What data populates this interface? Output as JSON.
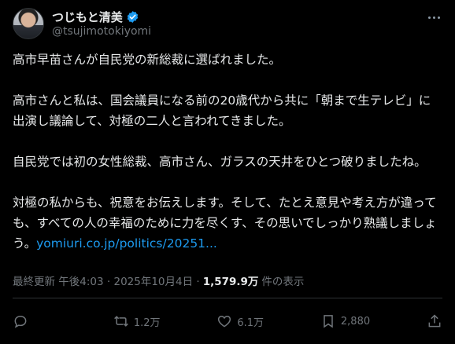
{
  "author": {
    "display_name": "つじもと清美",
    "handle": "@tsujimotokiyomi"
  },
  "post": {
    "paragraphs": [
      "高市早苗さんが自民党の新総裁に選ばれました。",
      "高市さんと私は、国会議員になる前の20歳代から共に「朝まで生テレビ」に出演し議論して、対極の二人と言われてきました。",
      "自民党では初の女性総裁、高市さん、ガラスの天井をひとつ破りましたね。"
    ],
    "last_paragraph_text": "対極の私からも、祝意をお伝えします。そして、たとえ意見や考え方が違っても、すべての人の幸福のために力を尽くす、その思いでしっかり熟議しましょう。",
    "link_text": "yomiuri.co.jp/politics/20251..."
  },
  "meta": {
    "prefix": "最終更新 午後4:03 · 2025年10月4日 ·",
    "views": "1,579.9万",
    "views_label": "件の表示"
  },
  "actions": {
    "reply": "",
    "repost": "1.2万",
    "like": "6.1万",
    "bookmark": "2,880"
  },
  "colors": {
    "background": "#000000",
    "text": "#e7e9ea",
    "muted": "#71767b",
    "link": "#1d9bf0",
    "verified": "#1d9bf0"
  },
  "icons": [
    "verified-badge-icon",
    "more-icon",
    "reply-icon",
    "repost-icon",
    "like-icon",
    "bookmark-icon",
    "share-icon"
  ]
}
